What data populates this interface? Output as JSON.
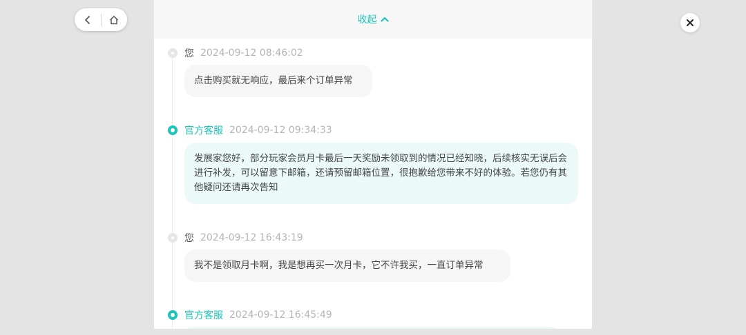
{
  "header": {
    "collapse_label": "收起"
  },
  "messages": [
    {
      "role": "user",
      "sender": "您",
      "time": "2024-09-12 08:46:02",
      "text": "点击购买就无响应，最后来个订单异常"
    },
    {
      "role": "agent",
      "sender": "官方客服",
      "time": "2024-09-12 09:34:33",
      "text": "发展家您好，部分玩家会员月卡最后一天奖励未领取到的情况已经知晓，后续核实无误后会进行补发，可以留意下邮箱，还请预留邮箱位置，很抱歉给您带来不好的体验。若您仍有其他疑问还请再次告知"
    },
    {
      "role": "user",
      "sender": "您",
      "time": "2024-09-12 16:43:19",
      "text": "我不是领取月卡啊，我是想再买一次月卡，它不许我买，一直订单异常"
    },
    {
      "role": "agent",
      "sender": "官方客服",
      "time": "2024-09-12 16:45:49",
      "text": ""
    }
  ],
  "colors": {
    "accent": "#1fc3b9",
    "agent_bubble": "#ebf9f9",
    "user_bubble": "#f6f6f6"
  },
  "icons": {
    "back": "chevron-left-icon",
    "home": "home-icon",
    "close": "close-icon",
    "collapse": "chevron-up-icon"
  }
}
